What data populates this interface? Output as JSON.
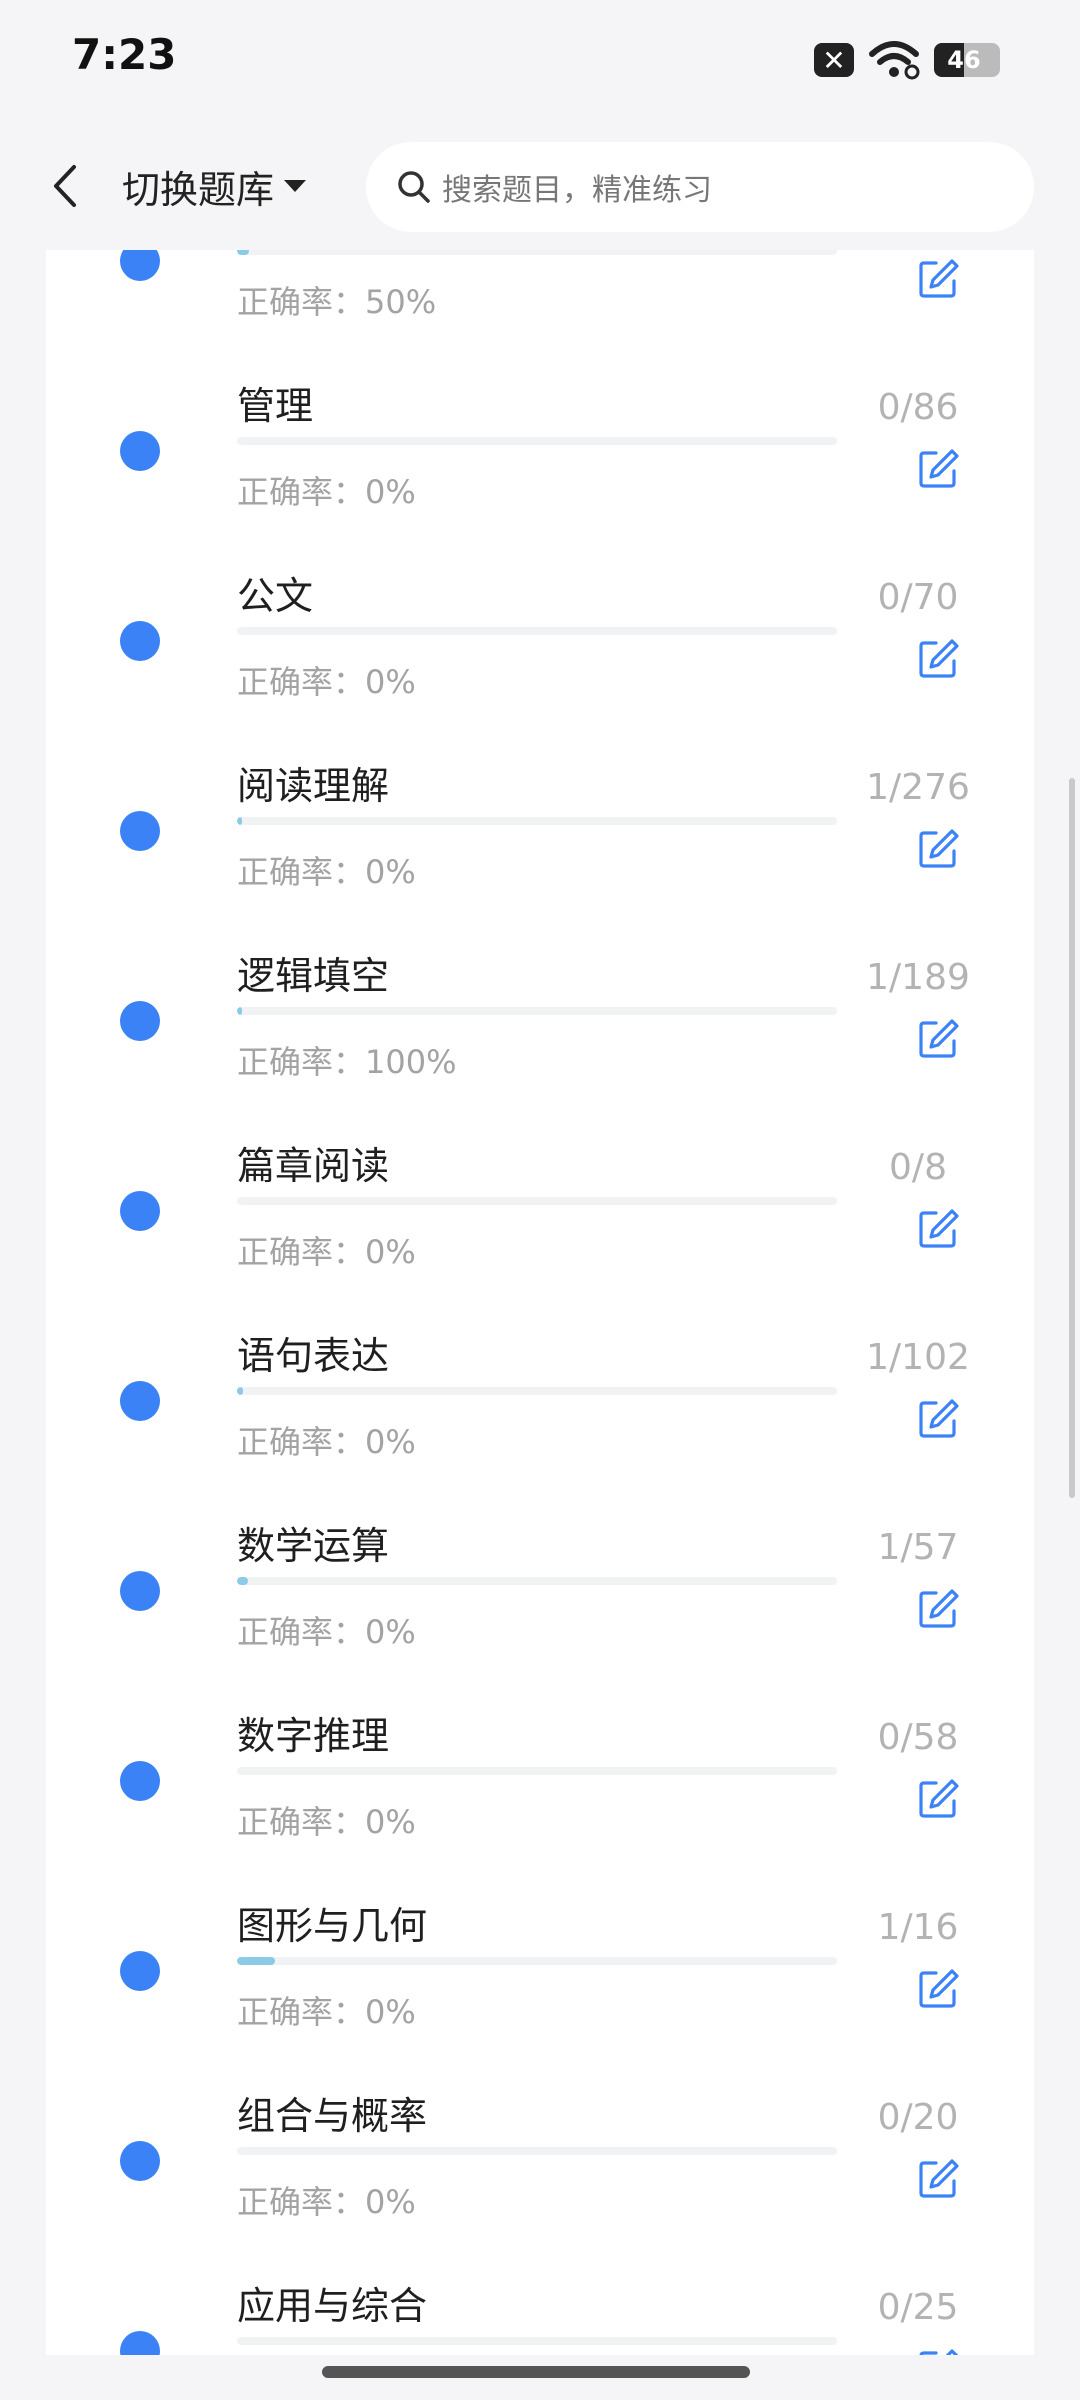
{
  "status_bar": {
    "time": "7:23",
    "battery": "46",
    "battery_level": 0.46
  },
  "header": {
    "bank_switch_label": "切换题库",
    "search_placeholder": "搜索题目，精准练习"
  },
  "colors": {
    "accent": "#3b82f6",
    "progress_fill": "#8ccbe8",
    "muted_text": "#a3a3a3"
  },
  "list": {
    "items": [
      {
        "title": "",
        "accuracy": "正确率：50%",
        "count": "",
        "progress": 0.02
      },
      {
        "title": "管理",
        "accuracy": "正确率：0%",
        "count": "0/86",
        "progress": 0
      },
      {
        "title": "公文",
        "accuracy": "正确率：0%",
        "count": "0/70",
        "progress": 0
      },
      {
        "title": "阅读理解",
        "accuracy": "正确率：0%",
        "count": "1/276",
        "progress": 0.0036
      },
      {
        "title": "逻辑填空",
        "accuracy": "正确率：100%",
        "count": "1/189",
        "progress": 0.0053
      },
      {
        "title": "篇章阅读",
        "accuracy": "正确率：0%",
        "count": "0/8",
        "progress": 0
      },
      {
        "title": "语句表达",
        "accuracy": "正确率：0%",
        "count": "1/102",
        "progress": 0.0098
      },
      {
        "title": "数学运算",
        "accuracy": "正确率：0%",
        "count": "1/57",
        "progress": 0.0175
      },
      {
        "title": "数字推理",
        "accuracy": "正确率：0%",
        "count": "0/58",
        "progress": 0
      },
      {
        "title": "图形与几何",
        "accuracy": "正确率：0%",
        "count": "1/16",
        "progress": 0.0625
      },
      {
        "title": "组合与概率",
        "accuracy": "正确率：0%",
        "count": "0/20",
        "progress": 0
      },
      {
        "title": "应用与综合",
        "accuracy": "",
        "count": "0/25",
        "progress": 0
      }
    ]
  }
}
